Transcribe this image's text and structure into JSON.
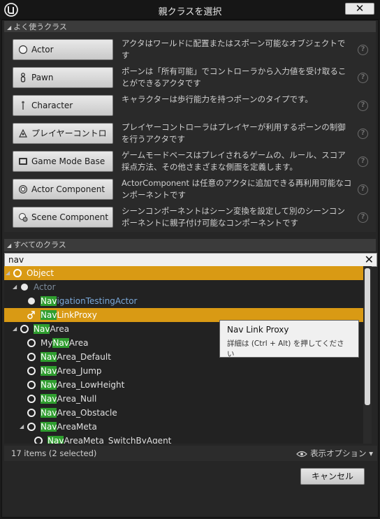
{
  "window": {
    "title": "親クラスを選択",
    "close_label": "✕"
  },
  "common_classes": {
    "header": "よく使うクラス",
    "items": [
      {
        "label": "Actor",
        "description": "アクタはワールドに配置またはスポーン可能なオブジェクトです",
        "icon": "actor-sphere-icon"
      },
      {
        "label": "Pawn",
        "description": "ポーンは「所有可能」でコントローラから入力値を受け取ることができるアクタです",
        "icon": "pawn-figure-icon"
      },
      {
        "label": "Character",
        "description": "キャラクターは歩行能力を持つポーンのタイプです。",
        "icon": "character-figure-icon"
      },
      {
        "label": "プレイヤーコントロ",
        "description": "プレイヤーコントローラはプレイヤーが利用するポーンの制御を行うアクタです",
        "icon": "player-controller-icon"
      },
      {
        "label": "Game Mode Base",
        "description": "ゲームモードベースはプレイされるゲームの、ルール、スコア採点方法、その他さまざまな側面を定義します。",
        "icon": "game-mode-icon"
      },
      {
        "label": "Actor Component",
        "description": "ActorComponent は任意のアクタに追加できる再利用可能なコンポーネントです",
        "icon": "actor-component-icon"
      },
      {
        "label": "Scene Component",
        "description": "シーンコンポーネントはシーン変換を設定して別のシーンコンポーネントに親子付け可能なコンポーネントです",
        "icon": "scene-component-icon"
      }
    ],
    "help_glyph": "?"
  },
  "all_classes": {
    "header": "すべてのクラス",
    "search_value": "nav",
    "clear_glyph": "✕",
    "tree": [
      {
        "pre": "",
        "hl": "",
        "post": "Object",
        "style": "sel",
        "expander": "◢"
      },
      {
        "pre": "",
        "hl": "",
        "post": "Actor",
        "style": "dim",
        "expander": "◢"
      },
      {
        "pre": "",
        "hl": "Nav",
        "post": "igationTestingActor",
        "style": "linkblue",
        "expander": ""
      },
      {
        "pre": "",
        "hl": "Nav",
        "post": "LinkProxy",
        "style": "sel",
        "expander": ""
      },
      {
        "pre": "",
        "hl": "Nav",
        "post": "Area",
        "style": "normal",
        "expander": "◢"
      },
      {
        "pre": "My",
        "hl": "Nav",
        "post": "Area",
        "style": "normal",
        "expander": ""
      },
      {
        "pre": "",
        "hl": "Nav",
        "post": "Area_Default",
        "style": "normal",
        "expander": ""
      },
      {
        "pre": "",
        "hl": "Nav",
        "post": "Area_Jump",
        "style": "normal",
        "expander": ""
      },
      {
        "pre": "",
        "hl": "Nav",
        "post": "Area_LowHeight",
        "style": "normal",
        "expander": ""
      },
      {
        "pre": "",
        "hl": "Nav",
        "post": "Area_Null",
        "style": "normal",
        "expander": ""
      },
      {
        "pre": "",
        "hl": "Nav",
        "post": "Area_Obstacle",
        "style": "normal",
        "expander": ""
      },
      {
        "pre": "",
        "hl": "Nav",
        "post": "AreaMeta",
        "style": "normal",
        "expander": "◢"
      },
      {
        "pre": "",
        "hl": "Nav",
        "post": "AreaMeta_SwitchByAgent",
        "style": "normal",
        "expander": ""
      }
    ],
    "tooltip": {
      "title": "Nav Link Proxy",
      "hint": "詳細は (Ctrl + Alt) を押してください"
    },
    "status_count": "17 items (2 selected)",
    "view_options_label": "表示オプション",
    "view_options_caret": "▾"
  },
  "footer": {
    "cancel_label": "キャンセル"
  },
  "colors": {
    "selection": "#d99a14",
    "search_highlight": "#2f9e2f"
  }
}
